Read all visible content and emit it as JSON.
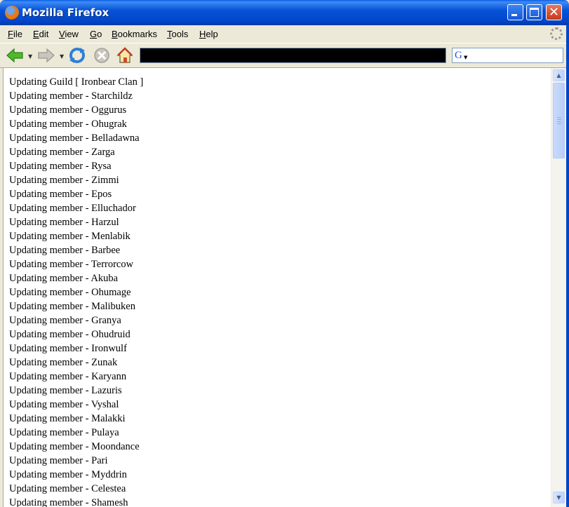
{
  "window": {
    "title": "Mozilla Firefox"
  },
  "menu": {
    "items": [
      {
        "key": "F",
        "rest": "ile"
      },
      {
        "key": "E",
        "rest": "dit"
      },
      {
        "key": "V",
        "rest": "iew"
      },
      {
        "key": "G",
        "rest": "o"
      },
      {
        "key": "B",
        "rest": "ookmarks"
      },
      {
        "key": "T",
        "rest": "ools"
      },
      {
        "key": "H",
        "rest": "elp"
      }
    ]
  },
  "toolbar": {
    "url_value": "",
    "search_value": "",
    "search_engine_glyph": "G"
  },
  "content": {
    "lines": [
      "Updating Guild [ Ironbear Clan ]",
      "Updating member - Starchildz",
      "Updating member - Oggurus",
      "Updating member - Ohugrak",
      "Updating member - Belladawna",
      "Updating member - Zarga",
      "Updating member - Rysa",
      "Updating member - Zimmi",
      "Updating member - Epos",
      "Updating member - Elluchador",
      "Updating member - Harzul",
      "Updating member - Menlabik",
      "Updating member - Barbee",
      "Updating member - Terrorcow",
      "Updating member - Akuba",
      "Updating member - Ohumage",
      "Updating member - Malibuken",
      "Updating member - Granya",
      "Updating member - Ohudruid",
      "Updating member - Ironwulf",
      "Updating member - Zunak",
      "Updating member - Karyann",
      "Updating member - Lazuris",
      "Updating member - Vyshal",
      "Updating member - Malakki",
      "Updating member - Pulaya",
      "Updating member - Moondance",
      "Updating member - Pari",
      "Updating member - Myddrin",
      "Updating member - Celestea",
      "Updating member - Shamesh"
    ]
  },
  "colors": {
    "titlebar": "#0054E3",
    "close_button": "#D8492A",
    "window_face": "#ECE9D8",
    "url_bar": "#000000"
  },
  "icons": {
    "back": "back-arrow-icon",
    "forward": "forward-arrow-icon",
    "reload": "reload-icon",
    "stop": "stop-icon",
    "home": "home-icon"
  }
}
